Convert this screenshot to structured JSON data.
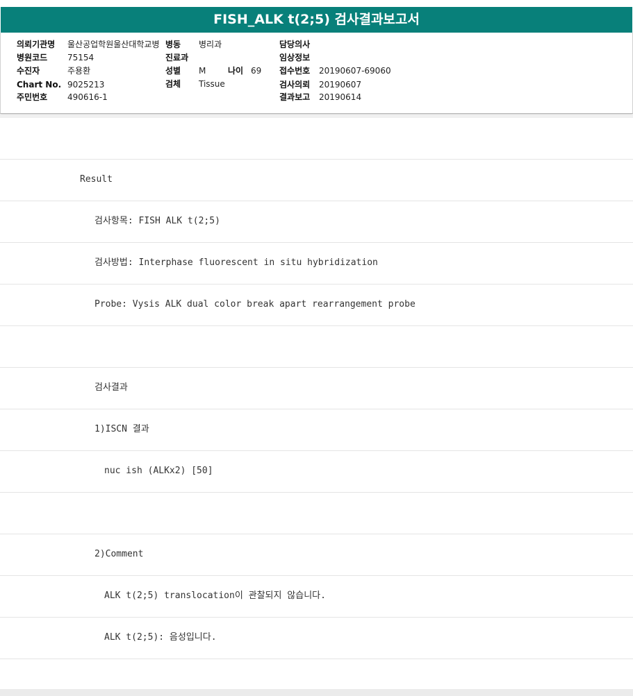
{
  "report": {
    "title": "FISH_ALK t(2;5) 검사결과보고서"
  },
  "header": {
    "institution_label": "의뢰기관명",
    "institution_value": "울산공업학원울산대학교병",
    "ward_label": "병동",
    "ward_value": "병리과",
    "doctor_label": "담당의사",
    "doctor_value": "",
    "hospital_code_label": "병원코드",
    "hospital_code_value": "75154",
    "department_label": "진료과",
    "department_value": "",
    "clinical_info_label": "임상정보",
    "clinical_info_value": "",
    "patient_label": "수진자",
    "patient_value": "주용환",
    "sex_label": "성별",
    "sex_value": "M",
    "age_label": "나이",
    "age_value": "69",
    "receipt_no_label": "접수번호",
    "receipt_no_value": "20190607-69060",
    "chart_no_label": "Chart No.",
    "chart_no_value": "9025213",
    "specimen_label": "검체",
    "specimen_value": "Tissue",
    "request_date_label": "검사의뢰",
    "request_date_value": "20190607",
    "resident_no_label": "주민번호",
    "resident_no_value": "490616-1",
    "report_date_label": "결과보고",
    "report_date_value": "20190614"
  },
  "result_lines": [
    "",
    "Result",
    "검사항목: FISH ALK t(2;5)",
    "검사방법: Interphase fluorescent in situ hybridization",
    "Probe: Vysis ALK dual color break apart rearrangement probe",
    "",
    "검사결과",
    "1)ISCN 결과",
    "nuc ish (ALKx2) [50]",
    "",
    "2)Comment",
    "ALK t(2;5) translocation이 관찰되지 않습니다.",
    "ALK t(2;5): 음성입니다."
  ]
}
